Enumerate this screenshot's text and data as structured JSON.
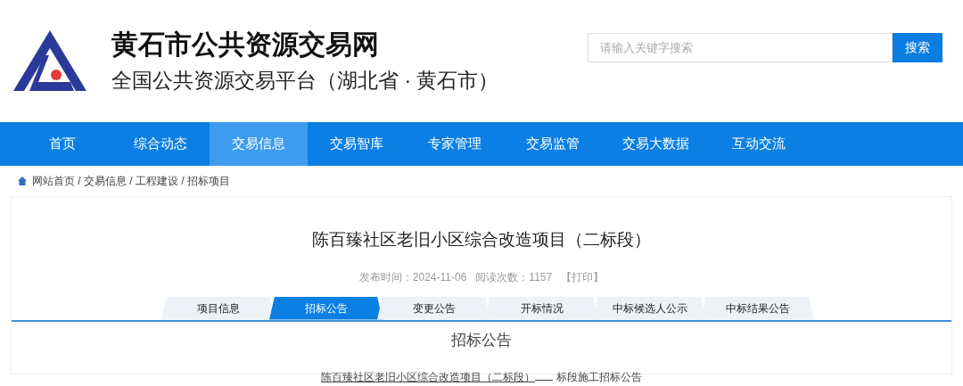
{
  "header": {
    "site_title": "黄石市公共资源交易网",
    "subtitle": "全国公共资源交易平台（湖北省 · 黄石市）"
  },
  "search": {
    "placeholder": "请输入关键字搜索",
    "button": "搜索"
  },
  "nav": [
    {
      "label": "首页",
      "selected": false
    },
    {
      "label": "综合动态",
      "selected": false
    },
    {
      "label": "交易信息",
      "selected": true
    },
    {
      "label": "交易智库",
      "selected": false
    },
    {
      "label": "专家管理",
      "selected": false
    },
    {
      "label": "交易监管",
      "selected": false
    },
    {
      "label": "交易大数据",
      "selected": false
    },
    {
      "label": "互动交流",
      "selected": false
    }
  ],
  "breadcrumb": "网站首页 / 交易信息 / 工程建设 / 招标项目",
  "article": {
    "title": "陈百臻社区老旧小区综合改造项目（二标段）",
    "publish_time": "发布时间：2024-11-06",
    "read_count": "阅读次数：1157",
    "print": "【打印】"
  },
  "tabs": [
    {
      "label": "项目信息",
      "selected": false
    },
    {
      "label": "招标公告",
      "selected": true
    },
    {
      "label": "变更公告",
      "selected": false
    },
    {
      "label": "开标情况",
      "selected": false
    },
    {
      "label": "中标候选人公示",
      "selected": false
    },
    {
      "label": "中标结果公告",
      "selected": false
    }
  ],
  "notice": {
    "heading": "招标公告",
    "project_name": "陈百臻社区老旧小区综合改造项目（二标段）",
    "suffix": "标段施工招标公告"
  }
}
